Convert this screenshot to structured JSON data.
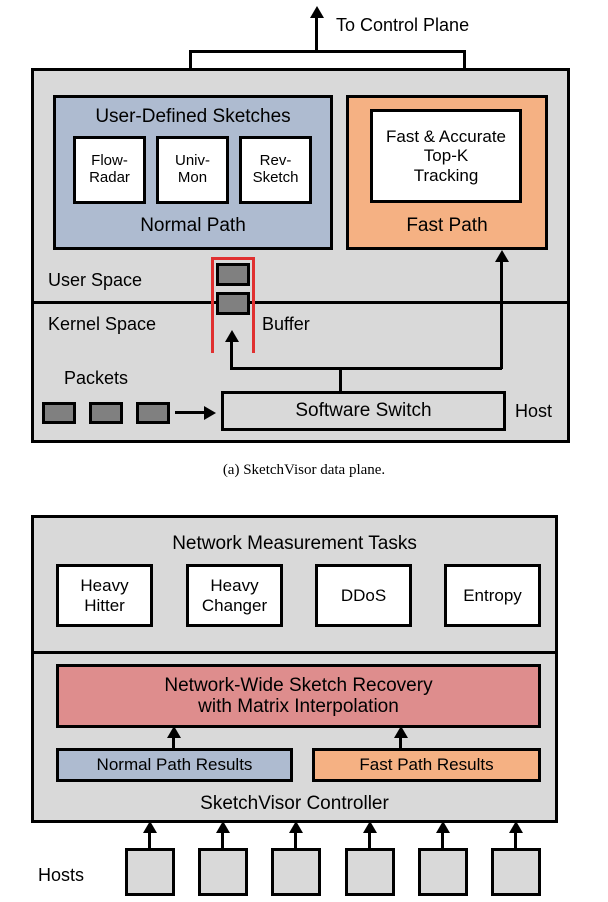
{
  "figure_a": {
    "top_label": "To Control Plane",
    "normal_path": {
      "title": "User-Defined Sketches",
      "footer": "Normal Path",
      "sketches": [
        {
          "line1": "Flow-",
          "line2": "Radar"
        },
        {
          "line1": "Univ-",
          "line2": "Mon"
        },
        {
          "line1": "Rev-",
          "line2": "Sketch"
        }
      ],
      "color": "#aebbd0"
    },
    "fast_path": {
      "footer": "Fast Path",
      "inner_lines": [
        "Fast & Accurate",
        "Top-K",
        "Tracking"
      ],
      "color": "#f5b183"
    },
    "user_space_label": "User Space",
    "kernel_space_label": "Kernel Space",
    "buffer_label": "Buffer",
    "packets_label": "Packets",
    "software_switch_label": "Software Switch",
    "host_label": "Host",
    "buffer_bracket_color": "#e03030",
    "packet_color": "#808080",
    "packet_count": 3,
    "buffer_slot_count": 2,
    "caption": "(a)  SketchVisor data plane."
  },
  "figure_b": {
    "tasks_title": "Network Measurement Tasks",
    "tasks": [
      {
        "line1": "Heavy",
        "line2": "Hitter"
      },
      {
        "line1": "Heavy",
        "line2": "Changer"
      },
      {
        "line1": "DDoS",
        "line2": ""
      },
      {
        "line1": "Entropy",
        "line2": ""
      }
    ],
    "recovery": {
      "line1": "Network-Wide Sketch Recovery",
      "line2": "with Matrix Interpolation",
      "color": "#de8d8d"
    },
    "results": [
      {
        "label": "Normal Path Results",
        "color": "#aebbd0"
      },
      {
        "label": "Fast Path Results",
        "color": "#f5b183"
      }
    ],
    "controller_label": "SketchVisor Controller",
    "hosts_label": "Hosts",
    "host_count": 6
  }
}
